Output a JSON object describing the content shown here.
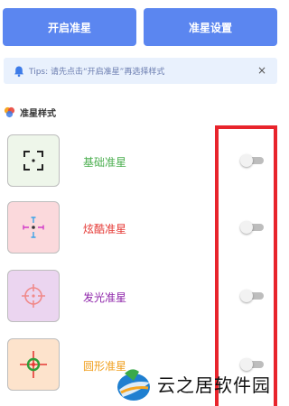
{
  "header": {
    "open_button": "开启准星",
    "settings_button": "准星设置"
  },
  "tips": {
    "text": "Tips: 请先点击“开启准星”再选择样式",
    "close": "×"
  },
  "section": {
    "title": "准星样式"
  },
  "styles": [
    {
      "label": "基础准星",
      "color": "#4caf50",
      "thumb_bg": "#eef6ea",
      "toggle_on": false
    },
    {
      "label": "炫酷准星",
      "color": "#e53935",
      "thumb_bg": "#fbd9dc",
      "toggle_on": false
    },
    {
      "label": "发光准星",
      "color": "#8e24aa",
      "thumb_bg": "#ebd5f0",
      "toggle_on": false
    },
    {
      "label": "圆形准星",
      "color": "#f0a020",
      "thumb_bg": "#fde3cc",
      "toggle_on": false
    }
  ],
  "colors": {
    "primary": "#5b86f0",
    "tips_bg": "#e9f1fd",
    "highlight": "#e8242c"
  },
  "watermark": {
    "text": "云之居软件园"
  }
}
